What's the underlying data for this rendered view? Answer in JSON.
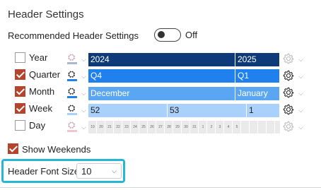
{
  "panel": {
    "title": "Header Settings",
    "recommended_label": "Recommended Header Settings",
    "recommended_state": "Off"
  },
  "rows": [
    {
      "label": "Year",
      "checked": false,
      "fill_color": "#a9b8cf"
    },
    {
      "label": "Quarter",
      "checked": true,
      "fill_color": "#1f80ee"
    },
    {
      "label": "Month",
      "checked": true,
      "fill_color": "#1f80ee"
    },
    {
      "label": "Week",
      "checked": true,
      "fill_color": "#a9d1fb"
    },
    {
      "label": "Day",
      "checked": false,
      "fill_color": "#f2c5cd"
    }
  ],
  "timeline": {
    "year": [
      "2024",
      "2025"
    ],
    "quarter": [
      "Q4",
      "Q1"
    ],
    "month": [
      "December",
      "January"
    ],
    "week": [
      "52",
      "53",
      "1"
    ],
    "day": [
      "19",
      "20",
      "21",
      "22",
      "23",
      "24",
      "25",
      "26",
      "27",
      "28",
      "29",
      "30",
      "31",
      "1",
      "2",
      "3",
      "4",
      "5"
    ]
  },
  "show_weekends": {
    "label": "Show Weekends",
    "checked": true
  },
  "font_size": {
    "label": "Header Font Size:",
    "value": "10"
  },
  "colors": {
    "accent_highlight": "#25b7d3",
    "checkbox": "#b5442d"
  }
}
